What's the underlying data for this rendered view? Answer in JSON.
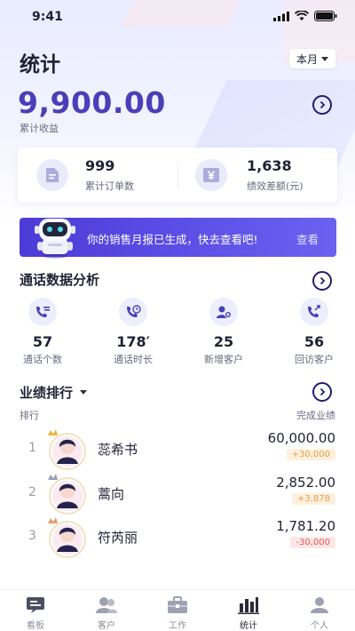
{
  "status": {
    "time": "9:41"
  },
  "page": {
    "title": "统计",
    "period": "本月"
  },
  "earnings": {
    "amount": "9,900.00",
    "label": "累计收益"
  },
  "summary": [
    {
      "value": "999",
      "label": "累计订单数",
      "icon": "document-icon"
    },
    {
      "value": "1,638",
      "label": "绩效差额(元)",
      "icon": "yen-icon"
    }
  ],
  "banner": {
    "text": "你的销售月报已生成，快去查看吧!",
    "link": "查看"
  },
  "call_analysis": {
    "title": "通话数据分析",
    "items": [
      {
        "value": "57",
        "label": "通话个数",
        "icon": "phone-list-icon"
      },
      {
        "value": "178′",
        "label": "通话时长",
        "icon": "phone-clock-icon"
      },
      {
        "value": "25",
        "label": "新增客户",
        "icon": "add-user-icon"
      },
      {
        "value": "56",
        "label": "回访客户",
        "icon": "callback-icon"
      }
    ]
  },
  "ranking": {
    "title": "业绩排行",
    "col_rank": "排行",
    "col_perf": "完成业绩",
    "rows": [
      {
        "rank": "1",
        "name": "蕊希书",
        "amount": "60,000.00",
        "delta": "+30,000",
        "trend": "up",
        "crown": "#f2b33d"
      },
      {
        "rank": "2",
        "name": "蒿向",
        "amount": "2,852.00",
        "delta": "+3,878",
        "trend": "up",
        "crown": "#9aa0b5"
      },
      {
        "rank": "3",
        "name": "符芮丽",
        "amount": "1,781.20",
        "delta": "-30,000",
        "trend": "down",
        "crown": "#e0a26a"
      }
    ]
  },
  "tabs": [
    {
      "label": "看板",
      "icon": "board-icon"
    },
    {
      "label": "客户",
      "icon": "customers-icon"
    },
    {
      "label": "工作",
      "icon": "work-icon"
    },
    {
      "label": "统计",
      "icon": "stats-icon",
      "active": true
    },
    {
      "label": "个人",
      "icon": "profile-icon"
    }
  ],
  "colors": {
    "accent": "#4a3fb8",
    "banner": "#5b4ee6",
    "up": "#e5a04b",
    "down": "#e05b55"
  }
}
